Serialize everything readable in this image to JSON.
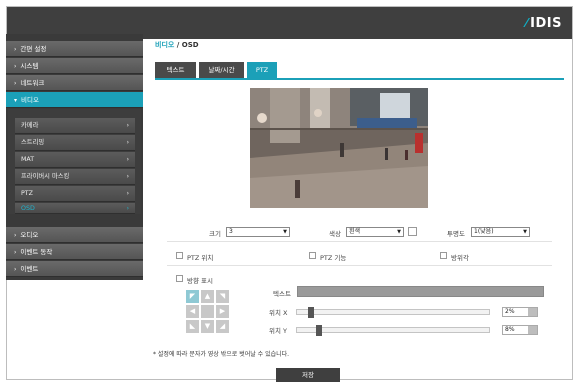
{
  "brand": {
    "logo_text": "IDIS",
    "accent": "#1ba0b8"
  },
  "sidebar": {
    "items": [
      {
        "label": "간편 설정"
      },
      {
        "label": "시스템"
      },
      {
        "label": "네트워크"
      },
      {
        "label": "비디오"
      },
      {
        "label": "오디오"
      },
      {
        "label": "이벤트 동작"
      },
      {
        "label": "이벤트"
      }
    ],
    "video_sub": [
      {
        "label": "카메라"
      },
      {
        "label": "스트리밍"
      },
      {
        "label": "MAT"
      },
      {
        "label": "프라이버시 마스킹"
      },
      {
        "label": "PTZ"
      },
      {
        "label": "OSD"
      }
    ]
  },
  "breadcrumb": {
    "parent": "비디오",
    "sep": " / ",
    "current": "OSD"
  },
  "tabs": [
    {
      "label": "텍스트"
    },
    {
      "label": "날짜/시간"
    },
    {
      "label": "PTZ"
    }
  ],
  "settings": {
    "size_label": "크기",
    "size_value": "3",
    "color_label": "색상",
    "color_value": "흰색",
    "opacity_label": "투명도",
    "opacity_value": "1(낮음)",
    "ptz_position_label": "PTZ 위치",
    "ptz_function_label": "PTZ 기능",
    "azimuth_label": "방위각",
    "direction_label": "방향 표시",
    "text_label": "텍스트",
    "pos_x_label": "위치 X",
    "pos_x_value": "2%",
    "pos_x_level": 0.02,
    "pos_y_label": "위치 Y",
    "pos_y_value": "8%",
    "pos_y_level": 0.08
  },
  "note": "* 설정에 따라 문자가 영상 밖으로 벗어날 수 있습니다.",
  "save_label": "저장"
}
